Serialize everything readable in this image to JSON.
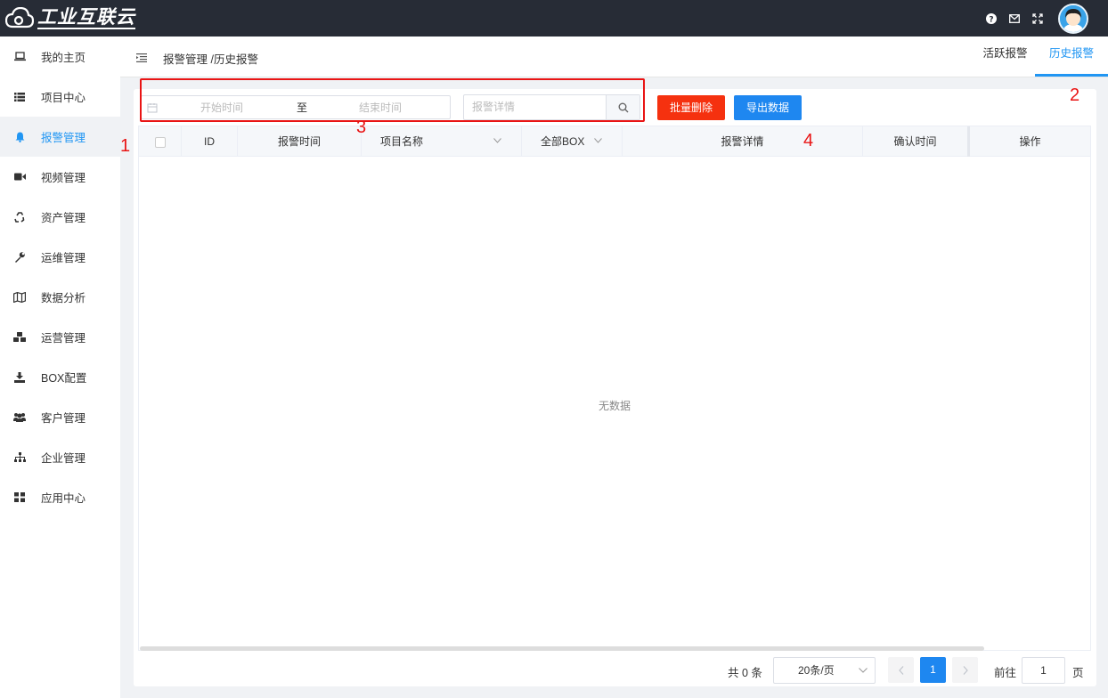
{
  "app": {
    "logo_text": "工业互联云"
  },
  "topbar": {
    "icons": [
      "help-icon",
      "mail-icon",
      "fullscreen-icon"
    ]
  },
  "sidebar": {
    "items": [
      {
        "label": "我的主页",
        "icon": "laptop-icon"
      },
      {
        "label": "项目中心",
        "icon": "list-icon"
      },
      {
        "label": "报警管理",
        "icon": "bell-icon",
        "active": true
      },
      {
        "label": "视频管理",
        "icon": "video-icon"
      },
      {
        "label": "资产管理",
        "icon": "recycle-icon"
      },
      {
        "label": "运维管理",
        "icon": "wrench-icon"
      },
      {
        "label": "数据分析",
        "icon": "map-icon"
      },
      {
        "label": "运营管理",
        "icon": "cubes-icon"
      },
      {
        "label": "BOX配置",
        "icon": "download-icon"
      },
      {
        "label": "客户管理",
        "icon": "users-icon"
      },
      {
        "label": "企业管理",
        "icon": "sitemap-icon"
      },
      {
        "label": "应用中心",
        "icon": "grid-icon"
      }
    ]
  },
  "header": {
    "breadcrumb": "报警管理 /历史报警",
    "tabs": [
      {
        "label": "活跃报警"
      },
      {
        "label": "历史报警",
        "active": true
      }
    ]
  },
  "filters": {
    "start_placeholder": "开始时间",
    "range_separator": "至",
    "end_placeholder": "结束时间",
    "search_placeholder": "报警详情",
    "delete_button": "批量删除",
    "export_button": "导出数据"
  },
  "table": {
    "columns": [
      "ID",
      "报警时间",
      "项目名称",
      "全部BOX",
      "报警详情",
      "确认时间",
      "操作"
    ],
    "empty_text": "无数据"
  },
  "pagination": {
    "total_text": "共 0 条",
    "page_size": "20条/页",
    "current_page": "1",
    "goto_label": "前往",
    "goto_value": "1",
    "page_suffix": "页"
  },
  "annotations": {
    "labels": [
      "1",
      "2",
      "3",
      "4"
    ],
    "color": "#e91414"
  },
  "colors": {
    "accent": "#2196f3",
    "danger": "#f5310f",
    "primary": "#1e87f0",
    "topbar": "#272c36"
  }
}
